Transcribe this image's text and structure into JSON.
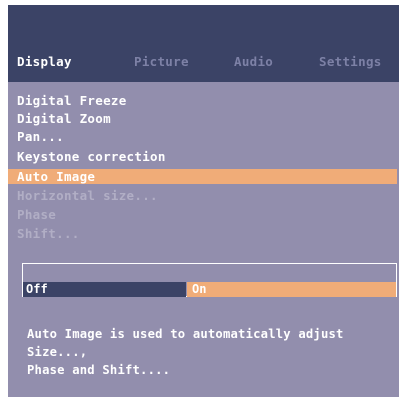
{
  "tabs": [
    {
      "label": "Display",
      "active": true
    },
    {
      "label": "Picture",
      "active": false
    },
    {
      "label": "Audio",
      "active": false
    },
    {
      "label": "Settings",
      "active": false
    }
  ],
  "menu": {
    "items": [
      {
        "label": "Digital Freeze",
        "state": "normal"
      },
      {
        "label": "Digital Zoom",
        "state": "normal"
      },
      {
        "label": "Pan...",
        "state": "normal"
      },
      {
        "label": "Keystone correction",
        "state": "normal"
      },
      {
        "label": "Auto Image",
        "state": "selected"
      },
      {
        "label": "Horizontal size...",
        "state": "disabled"
      },
      {
        "label": "Phase",
        "state": "disabled"
      },
      {
        "label": "Shift...",
        "state": "disabled"
      }
    ]
  },
  "value": {
    "off_label": "Off",
    "on_label": "On",
    "selected": "On"
  },
  "help": {
    "line1": "Auto Image is used to automatically adjust Size...,",
    "line2": "Phase and Shift...."
  },
  "colors": {
    "panel": "#928ead",
    "titlebar": "#3b4366",
    "highlight": "#f0ac78"
  }
}
